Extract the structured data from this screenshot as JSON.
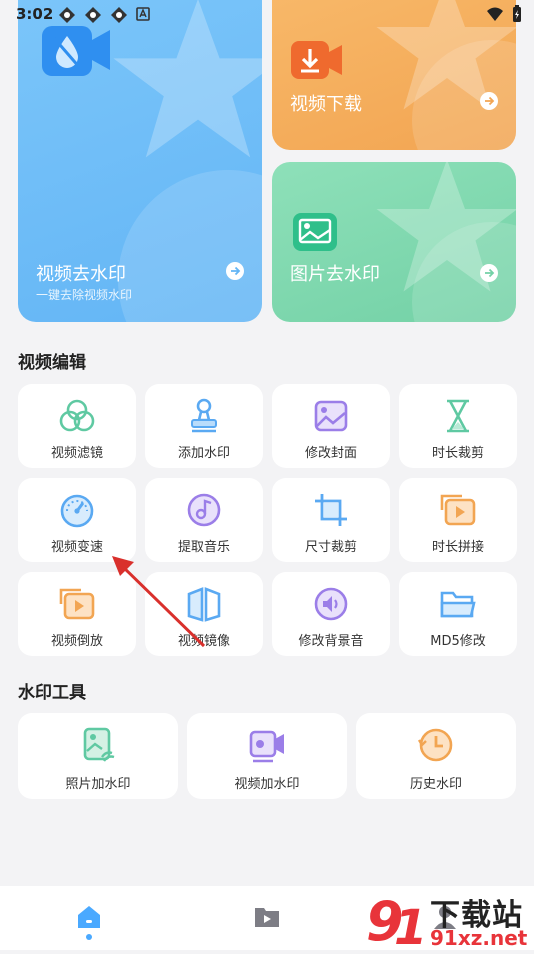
{
  "status_bar": {
    "time": "3:02"
  },
  "cards": {
    "video_remove_wm": {
      "title": "视频去水印",
      "subtitle": "一键去除视频水印"
    },
    "video_download": {
      "title": "视频下载"
    },
    "image_remove_wm": {
      "title": "图片去水印"
    }
  },
  "video_edit": {
    "title": "视频编辑",
    "items": [
      {
        "label": "视频滤镜"
      },
      {
        "label": "添加水印"
      },
      {
        "label": "修改封面"
      },
      {
        "label": "时长裁剪"
      },
      {
        "label": "视频变速"
      },
      {
        "label": "提取音乐"
      },
      {
        "label": "尺寸裁剪"
      },
      {
        "label": "时长拼接"
      },
      {
        "label": "视频倒放"
      },
      {
        "label": "视频镜像"
      },
      {
        "label": "修改背景音"
      },
      {
        "label": "MD5修改"
      }
    ]
  },
  "wm_tools": {
    "title": "水印工具",
    "items": [
      {
        "label": "照片加水印"
      },
      {
        "label": "视频加水印"
      },
      {
        "label": "历史水印"
      }
    ]
  },
  "watermark_logo": {
    "text_top": "下载站",
    "text_bottom": "91xz.net"
  },
  "colors": {
    "blue_card": "#6fbdf7",
    "orange_card": "#f4ac60",
    "green_card": "#7fd7ae",
    "accent_blue": "#4aa9ff",
    "annotation_red": "#d9302c"
  }
}
